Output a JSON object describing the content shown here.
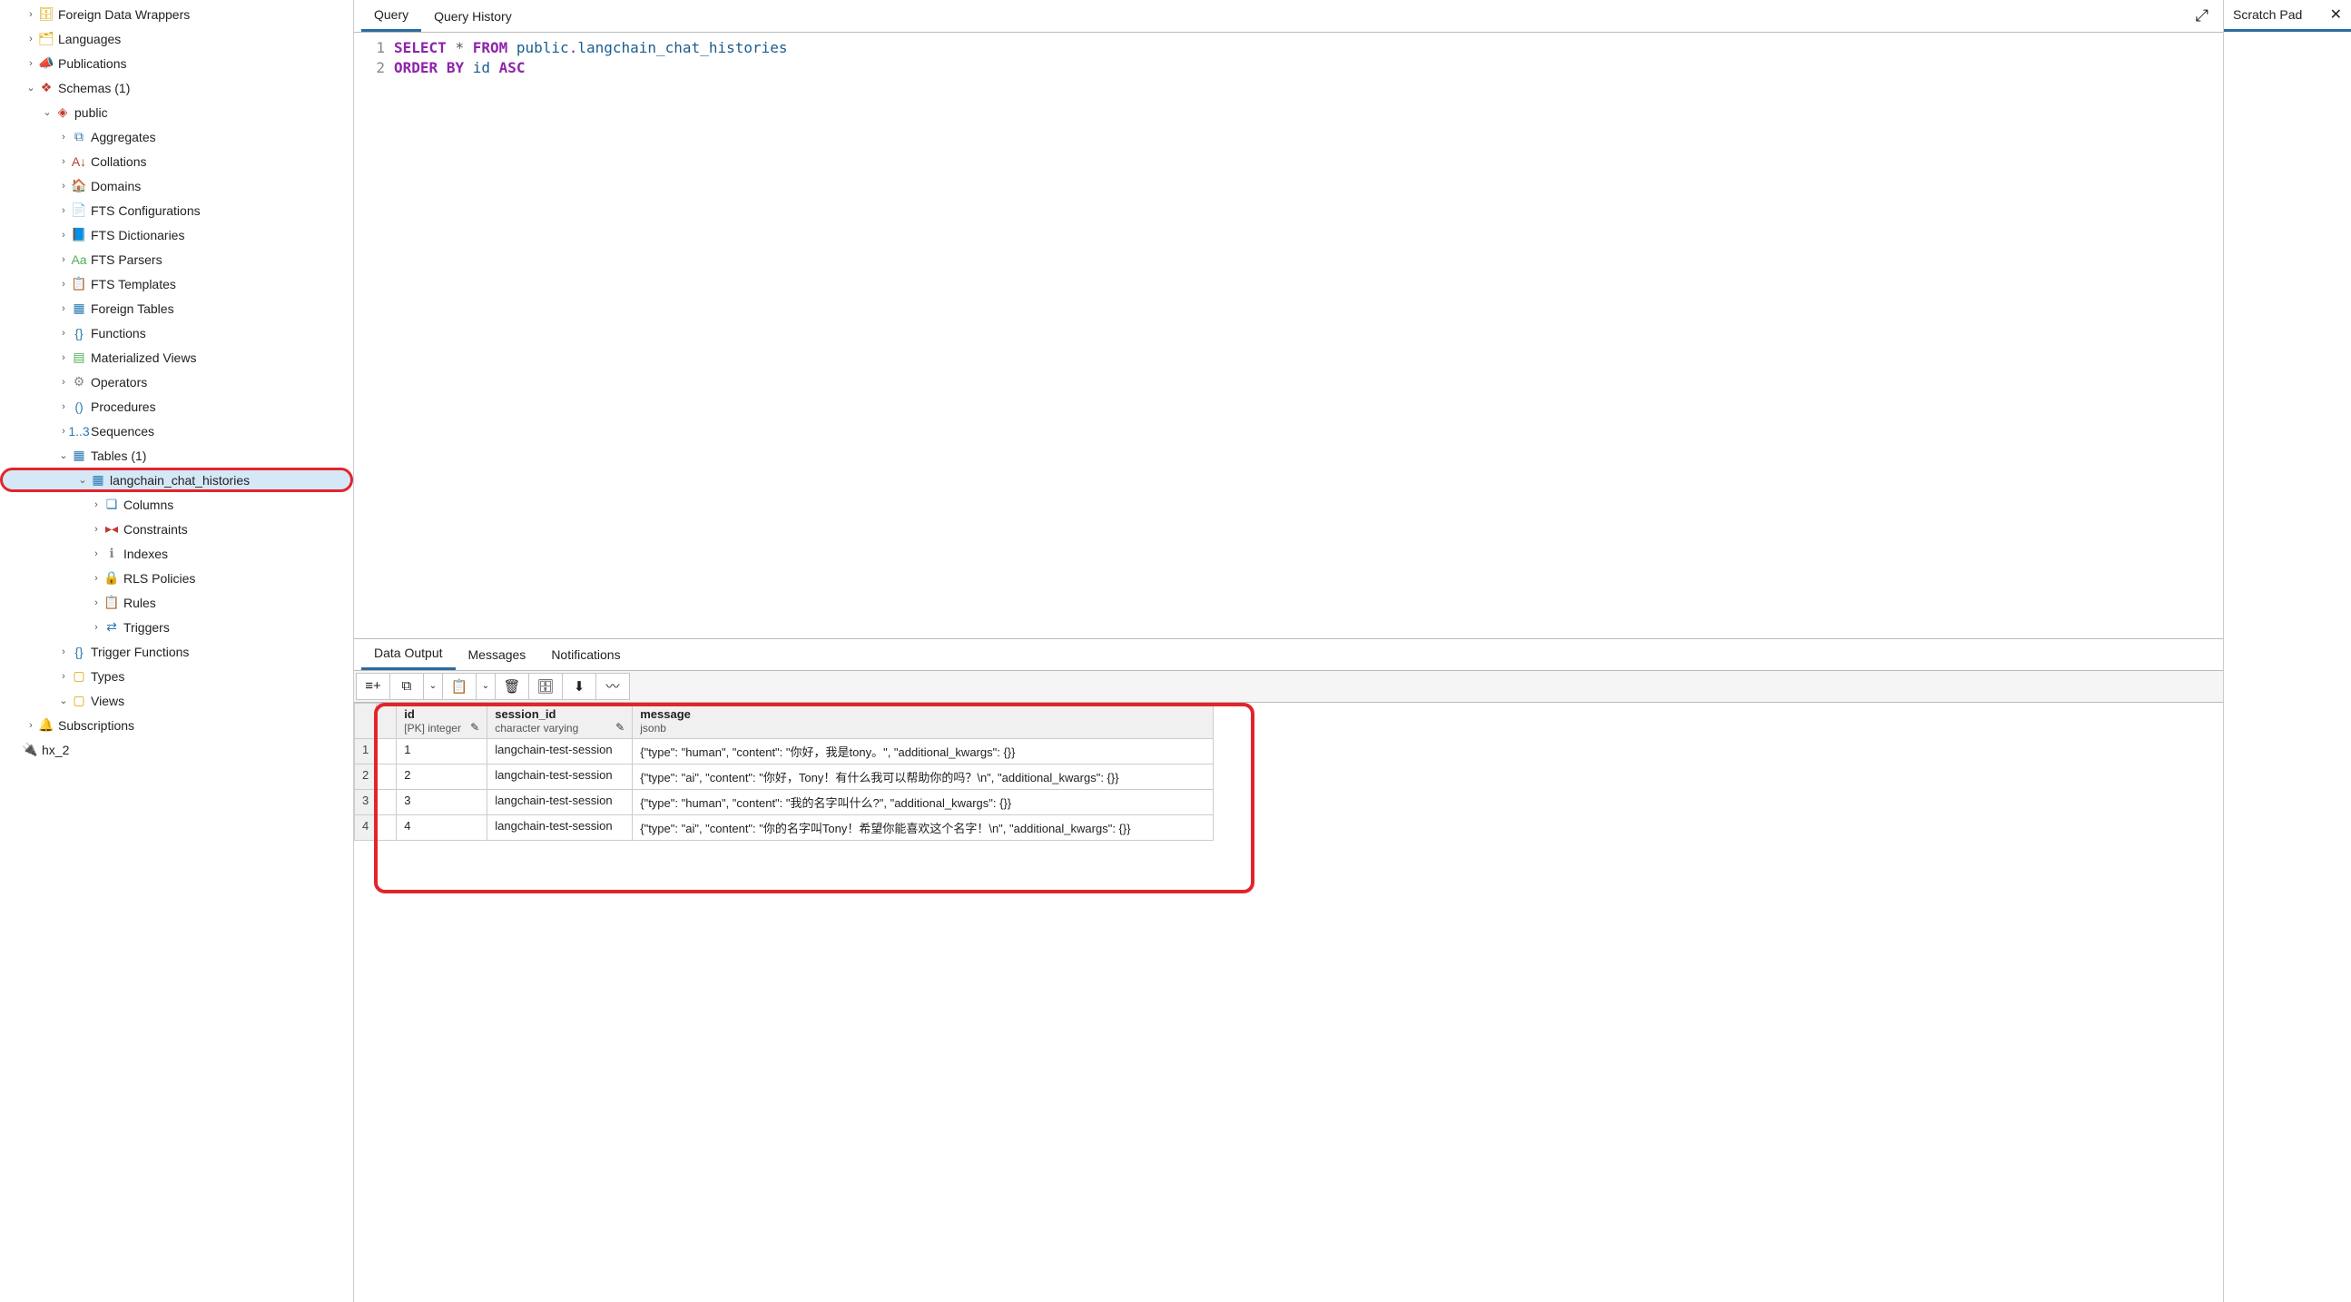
{
  "sidebar": {
    "items": [
      {
        "indent": 0,
        "chev": "›",
        "iconClass": "i-yellow",
        "glyph": "🗄",
        "label": "Foreign Data Wrappers"
      },
      {
        "indent": 0,
        "chev": "›",
        "iconClass": "i-yellow",
        "glyph": "🗂",
        "label": "Languages"
      },
      {
        "indent": 0,
        "chev": "›",
        "iconClass": "i-yellow",
        "glyph": "📣",
        "label": "Publications"
      },
      {
        "indent": 0,
        "chev": "⌄",
        "iconClass": "i-red",
        "glyph": "❖",
        "label": "Schemas (1)"
      },
      {
        "indent": 1,
        "chev": "⌄",
        "iconClass": "i-red",
        "glyph": "◈",
        "label": "public"
      },
      {
        "indent": 2,
        "chev": "›",
        "iconClass": "i-blue",
        "glyph": "⧉",
        "label": "Aggregates"
      },
      {
        "indent": 2,
        "chev": "›",
        "iconClass": "i-red",
        "glyph": "A↓",
        "label": "Collations"
      },
      {
        "indent": 2,
        "chev": "›",
        "iconClass": "i-orange",
        "glyph": "🏠",
        "label": "Domains"
      },
      {
        "indent": 2,
        "chev": "›",
        "iconClass": "i-blue",
        "glyph": "📄",
        "label": "FTS Configurations"
      },
      {
        "indent": 2,
        "chev": "›",
        "iconClass": "i-blue",
        "glyph": "📘",
        "label": "FTS Dictionaries"
      },
      {
        "indent": 2,
        "chev": "›",
        "iconClass": "i-green",
        "glyph": "Aa",
        "label": "FTS Parsers"
      },
      {
        "indent": 2,
        "chev": "›",
        "iconClass": "i-yellow",
        "glyph": "📋",
        "label": "FTS Templates"
      },
      {
        "indent": 2,
        "chev": "›",
        "iconClass": "i-blue",
        "glyph": "▦",
        "label": "Foreign Tables"
      },
      {
        "indent": 2,
        "chev": "›",
        "iconClass": "i-blue",
        "glyph": "{}",
        "label": "Functions"
      },
      {
        "indent": 2,
        "chev": "›",
        "iconClass": "i-green",
        "glyph": "▤",
        "label": "Materialized Views"
      },
      {
        "indent": 2,
        "chev": "›",
        "iconClass": "i-gray",
        "glyph": "⚙",
        "label": "Operators"
      },
      {
        "indent": 2,
        "chev": "›",
        "iconClass": "i-blue",
        "glyph": "()",
        "label": "Procedures"
      },
      {
        "indent": 2,
        "chev": "›",
        "iconClass": "i-blue",
        "glyph": "1..3",
        "label": "Sequences"
      },
      {
        "indent": 2,
        "chev": "⌄",
        "iconClass": "i-blue",
        "glyph": "▦",
        "label": "Tables (1)"
      },
      {
        "indent": 3,
        "chev": "⌄",
        "iconClass": "i-blue",
        "glyph": "▦",
        "label": "langchain_chat_histories",
        "highlighted": true
      },
      {
        "indent": 4,
        "chev": "›",
        "iconClass": "i-blue",
        "glyph": "❏",
        "label": "Columns"
      },
      {
        "indent": 4,
        "chev": "›",
        "iconClass": "i-red",
        "glyph": "▸◂",
        "label": "Constraints"
      },
      {
        "indent": 4,
        "chev": "›",
        "iconClass": "i-gray",
        "glyph": "ℹ",
        "label": "Indexes"
      },
      {
        "indent": 4,
        "chev": "›",
        "iconClass": "i-green",
        "glyph": "🔒",
        "label": "RLS Policies"
      },
      {
        "indent": 4,
        "chev": "›",
        "iconClass": "i-yellow",
        "glyph": "📋",
        "label": "Rules"
      },
      {
        "indent": 4,
        "chev": "›",
        "iconClass": "i-blue",
        "glyph": "⇄",
        "label": "Triggers"
      },
      {
        "indent": 2,
        "chev": "›",
        "iconClass": "i-blue",
        "glyph": "{}",
        "label": "Trigger Functions"
      },
      {
        "indent": 2,
        "chev": "›",
        "iconClass": "i-yellow",
        "glyph": "▢",
        "label": "Types"
      },
      {
        "indent": 2,
        "chev": "⌄",
        "iconClass": "i-yellow",
        "glyph": "▢",
        "label": "Views"
      },
      {
        "indent": 0,
        "chev": "›",
        "iconClass": "i-orange",
        "glyph": "🔔",
        "label": "Subscriptions"
      },
      {
        "indent": -1,
        "chev": "",
        "iconClass": "i-orange",
        "glyph": "🔌",
        "label": "hx_2"
      }
    ]
  },
  "tabs": {
    "query": "Query",
    "history": "Query History"
  },
  "scratch": {
    "label": "Scratch Pad"
  },
  "editor": {
    "lines": [
      "1",
      "2"
    ],
    "l1": {
      "select": "SELECT",
      "star": "*",
      "from": "FROM",
      "schema": "public",
      "dot": ".",
      "table": "langchain_chat_histories"
    },
    "l2": {
      "order": "ORDER",
      "by": "BY",
      "col": "id",
      "asc": "ASC"
    }
  },
  "resultsTabs": {
    "data": "Data Output",
    "msg": "Messages",
    "notif": "Notifications"
  },
  "columns": {
    "id": {
      "name": "id",
      "type": "[PK] integer"
    },
    "session": {
      "name": "session_id",
      "type": "character varying"
    },
    "message": {
      "name": "message",
      "type": "jsonb"
    }
  },
  "rows": [
    {
      "n": "1",
      "id": "1",
      "session": "langchain-test-session",
      "msg": "{\"type\": \"human\", \"content\": \"你好，我是tony。\", \"additional_kwargs\": {}}"
    },
    {
      "n": "2",
      "id": "2",
      "session": "langchain-test-session",
      "msg": "{\"type\": \"ai\", \"content\": \"你好，Tony！有什么我可以帮助你的吗？\\n\", \"additional_kwargs\": {}}"
    },
    {
      "n": "3",
      "id": "3",
      "session": "langchain-test-session",
      "msg": "{\"type\": \"human\", \"content\": \"我的名字叫什么?\", \"additional_kwargs\": {}}"
    },
    {
      "n": "4",
      "id": "4",
      "session": "langchain-test-session",
      "msg": "{\"type\": \"ai\", \"content\": \"你的名字叫Tony！希望你能喜欢这个名字！\\n\", \"additional_kwargs\": {}}"
    }
  ]
}
